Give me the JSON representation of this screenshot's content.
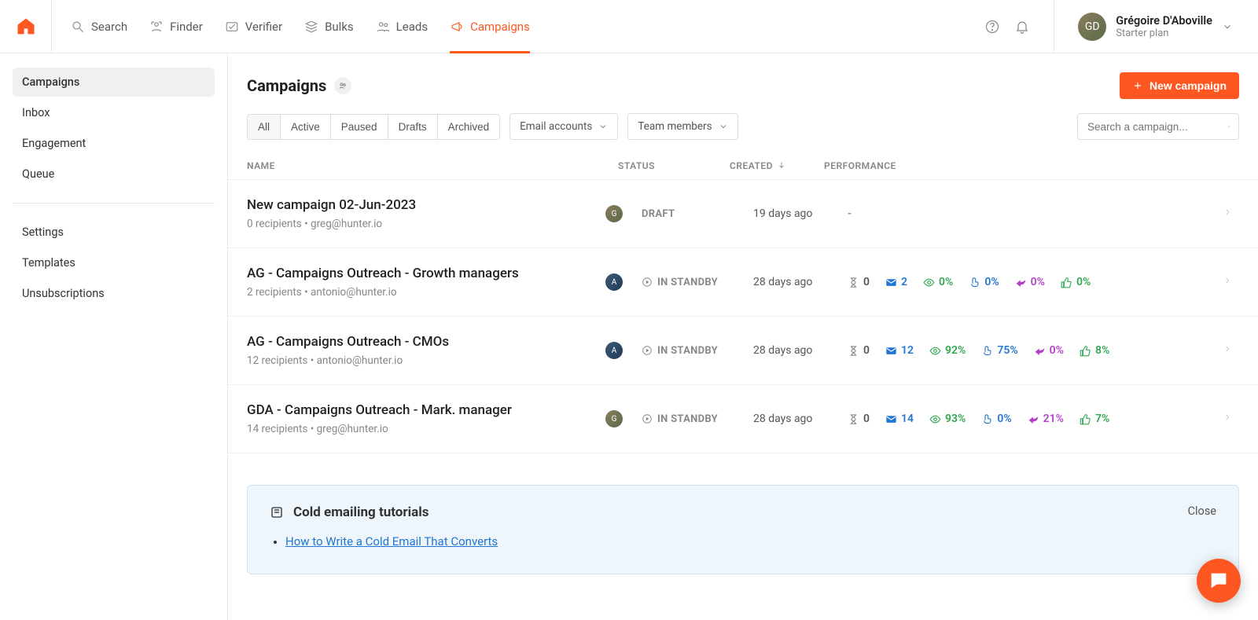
{
  "nav": {
    "items": [
      {
        "label": "Search"
      },
      {
        "label": "Finder"
      },
      {
        "label": "Verifier"
      },
      {
        "label": "Bulks"
      },
      {
        "label": "Leads"
      },
      {
        "label": "Campaigns"
      }
    ]
  },
  "user": {
    "name": "Grégoire D'Aboville",
    "plan": "Starter plan",
    "initials": "GD"
  },
  "sidebar": {
    "primary": [
      {
        "label": "Campaigns"
      },
      {
        "label": "Inbox"
      },
      {
        "label": "Engagement"
      },
      {
        "label": "Queue"
      }
    ],
    "secondary": [
      {
        "label": "Settings"
      },
      {
        "label": "Templates"
      },
      {
        "label": "Unsubscriptions"
      }
    ]
  },
  "page": {
    "title": "Campaigns",
    "new_button": "New campaign",
    "search_placeholder": "Search a campaign..."
  },
  "filters": {
    "segments": [
      "All",
      "Active",
      "Paused",
      "Drafts",
      "Archived"
    ],
    "dd1": "Email accounts",
    "dd2": "Team members"
  },
  "columns": {
    "name": "NAME",
    "status": "STATUS",
    "created": "CREATED",
    "perf": "PERFORMANCE"
  },
  "rows": [
    {
      "title": "New campaign 02-Jun-2023",
      "sub": "0 recipients • greg@hunter.io",
      "avatar": "G",
      "avatar_cls": "av-g",
      "status": "DRAFT",
      "status_kind": "draft",
      "created": "19 days ago",
      "perf": null
    },
    {
      "title": "AG - Campaigns Outreach - Growth managers",
      "sub": "2 recipients • antonio@hunter.io",
      "avatar": "A",
      "avatar_cls": "av-a",
      "status": "IN STANDBY",
      "status_kind": "standby",
      "created": "28 days ago",
      "perf": {
        "queue": "0",
        "sent": "2",
        "open": "0%",
        "click": "0%",
        "reply": "0%",
        "pos": "0%"
      }
    },
    {
      "title": "AG - Campaigns Outreach - CMOs",
      "sub": "12 recipients • antonio@hunter.io",
      "avatar": "A",
      "avatar_cls": "av-a",
      "status": "IN STANDBY",
      "status_kind": "standby",
      "created": "28 days ago",
      "perf": {
        "queue": "0",
        "sent": "12",
        "open": "92%",
        "click": "75%",
        "reply": "0%",
        "pos": "8%"
      }
    },
    {
      "title": "GDA - Campaigns Outreach - Mark. manager",
      "sub": "14 recipients • greg@hunter.io",
      "avatar": "G",
      "avatar_cls": "av-g",
      "status": "IN STANDBY",
      "status_kind": "standby",
      "created": "28 days ago",
      "perf": {
        "queue": "0",
        "sent": "14",
        "open": "93%",
        "click": "0%",
        "reply": "21%",
        "pos": "7%"
      }
    }
  ],
  "tutorials": {
    "title": "Cold emailing tutorials",
    "links": [
      {
        "text": "How to Write a Cold Email That Converts"
      }
    ],
    "close": "Close"
  },
  "dash": "-"
}
